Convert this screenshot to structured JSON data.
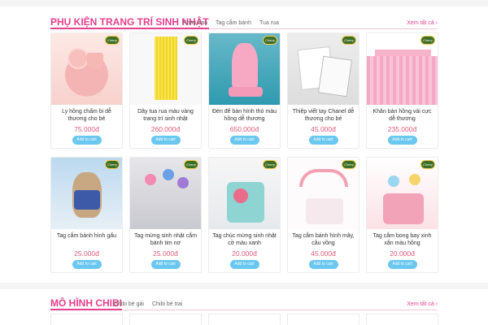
{
  "section1": {
    "title": "PHỤ KIỆN TRANG TRÍ SINH NHẬT",
    "tabs": [
      "Khăn bàn",
      "Tag cắm bánh",
      "Tua rua"
    ],
    "see_all": "Xem tất cả  ›",
    "products": [
      {
        "name": "Ly hồng chấm bi dễ thương cho bé",
        "price": "75.000đ",
        "cart": "Add to cart"
      },
      {
        "name": "Dây tua rua màu vàng trang trí sinh nhật",
        "price": "260.000đ",
        "cart": "Add to cart"
      },
      {
        "name": "Đèn để bàn hình thỏ màu hồng dễ thương",
        "price": "650.000đ",
        "cart": "Add to cart"
      },
      {
        "name": "Thiệp viết tay Chanel dễ thương cho bé",
        "price": "45.000đ",
        "cart": "Add to cart"
      },
      {
        "name": "Khăn bàn hồng vải cực dễ thương",
        "price": "235.000đ",
        "cart": "Add to cart"
      },
      {
        "name": "Tag cắm bánh hình gấu",
        "price": "25.000đ",
        "cart": "Add to cart"
      },
      {
        "name": "Tag mừng sinh nhật cắm bánh tim nơ",
        "price": "25.000đ",
        "cart": "Add to cart"
      },
      {
        "name": "Tag chúc mừng sinh nhật cờ màu xanh",
        "price": "20.000đ",
        "cart": "Add to cart"
      },
      {
        "name": "Tag cắm bánh hình mây, cầu vồng",
        "price": "45.000đ",
        "cart": "Add to cart"
      },
      {
        "name": "Tag cắm bong bay xinh xắn màu hồng",
        "price": "20.000đ",
        "cart": "Add to cart"
      }
    ]
  },
  "section2": {
    "title": "MÔ HÌNH CHIBI",
    "tabs": [
      "Chibi bé gái",
      "Chibi bé trai"
    ],
    "see_all": "Xem tất cả  ›"
  },
  "badge_text": "Cherry"
}
